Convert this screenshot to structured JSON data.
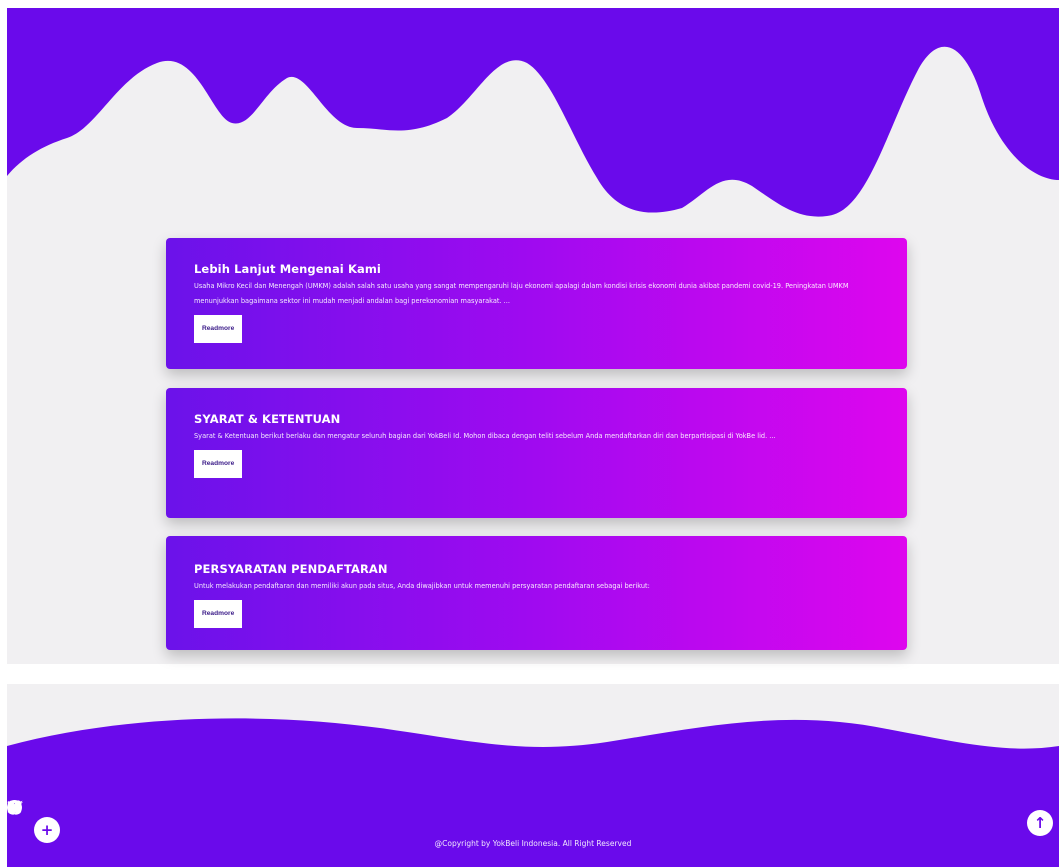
{
  "colors": {
    "primary": "#6a0aeb",
    "background": "#f1f0f2",
    "gradient_start": "#6b12ea",
    "gradient_end": "#de06ee"
  },
  "cards": [
    {
      "title": "Lebih Lanjut Mengenai Kami",
      "text": "Usaha Mikro Kecil dan Menengah (UMKM) adalah salah satu usaha yang sangat mempengaruhi laju ekonomi apalagi dalam kondisi krisis ekonomi dunia akibat pandemi covid-19. Peningkatan UMKM menunjukkan bagaimana sektor ini mudah menjadi andalan bagi perekonomian masyarakat. ...",
      "button": "Readmore"
    },
    {
      "title": "SYARAT & KETENTUAN",
      "text": "Syarat & Ketentuan berikut berlaku dan mengatur seluruh bagian dari YokBeli Id. Mohon dibaca dengan teliti sebelum Anda mendaftarkan diri dan berpartisipasi di YokBe lid. ...",
      "button": "Readmore"
    },
    {
      "title": "PERSYARATAN PENDAFTARAN",
      "text": "Untuk melakukan pendaftaran dan memiliki akun pada situs, Anda diwajibkan untuk memenuhi persyaratan pendaftaran sebagai berikut:",
      "button": "Readmore"
    }
  ],
  "footer": {
    "social_icons": [
      "facebook-icon",
      "twitter-icon",
      "instagram-icon"
    ],
    "copyright": "@Copyright by YokBeli Indonesia. All Right Reserved"
  },
  "fab": {
    "plus_icon": "+",
    "up_icon": "↑"
  }
}
